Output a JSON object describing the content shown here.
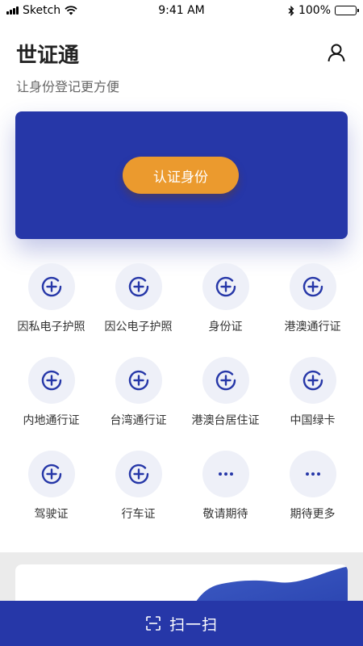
{
  "status_bar": {
    "carrier": "Sketch",
    "time": "9:41 AM",
    "battery": "100%"
  },
  "header": {
    "title": "世证通",
    "subtitle": "让身份登记更方便",
    "profile_icon": "user-icon"
  },
  "hero": {
    "button_label": "认证身份",
    "card_color": "#2637a8",
    "button_color": "#eb9a2e"
  },
  "grid": {
    "items": [
      {
        "label": "因私电子护照",
        "icon": "plus-circle-icon"
      },
      {
        "label": "因公电子护照",
        "icon": "plus-circle-icon"
      },
      {
        "label": "身份证",
        "icon": "plus-circle-icon"
      },
      {
        "label": "港澳通行证",
        "icon": "plus-circle-icon"
      },
      {
        "label": "内地通行证",
        "icon": "plus-circle-icon"
      },
      {
        "label": "台湾通行证",
        "icon": "plus-circle-icon"
      },
      {
        "label": "港澳台居住证",
        "icon": "plus-circle-icon"
      },
      {
        "label": "中国绿卡",
        "icon": "plus-circle-icon"
      },
      {
        "label": "驾驶证",
        "icon": "plus-circle-icon"
      },
      {
        "label": "行车证",
        "icon": "plus-circle-icon"
      },
      {
        "label": "敬请期待",
        "icon": "more-dots-icon"
      },
      {
        "label": "期待更多",
        "icon": "more-dots-icon"
      }
    ]
  },
  "scan_bar": {
    "label": "扫一扫",
    "icon": "scan-icon"
  }
}
